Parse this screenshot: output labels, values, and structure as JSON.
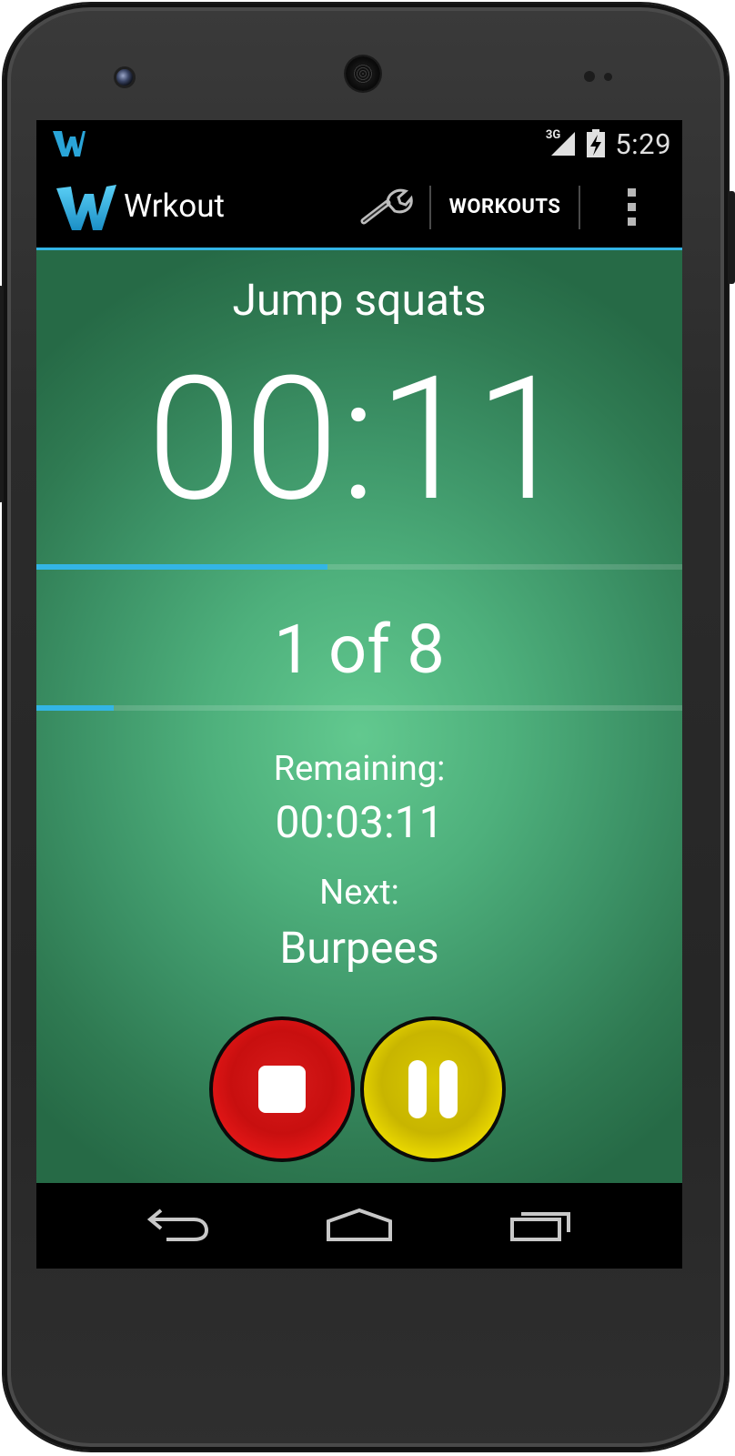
{
  "status_bar": {
    "network_type": "3G",
    "time": "5:29",
    "icons": [
      "wrkout-notification-icon",
      "signal-icon",
      "battery-charging-icon"
    ]
  },
  "action_bar": {
    "app_title": "Wrkout",
    "settings_icon": "wrench-icon",
    "workouts_label": "WORKOUTS",
    "overflow_icon": "overflow-menu-icon"
  },
  "workout": {
    "exercise_name": "Jump squats",
    "timer": "00:11",
    "exercise_progress": 0.45,
    "round_counter": "1 of 8",
    "round_progress": 0.12,
    "remaining_label": "Remaining:",
    "remaining_value": "00:03:11",
    "next_label": "Next:",
    "next_value": "Burpees"
  },
  "controls": {
    "stop_icon": "stop-icon",
    "pause_icon": "pause-icon",
    "stop_color": "#d41414",
    "pause_color": "#d4c300"
  },
  "nav_bar": {
    "icons": [
      "back-icon",
      "home-icon",
      "recent-apps-icon"
    ]
  },
  "colors": {
    "accent": "#33b5e5",
    "background_center": "#62c98f",
    "background_edge": "#266a46"
  }
}
